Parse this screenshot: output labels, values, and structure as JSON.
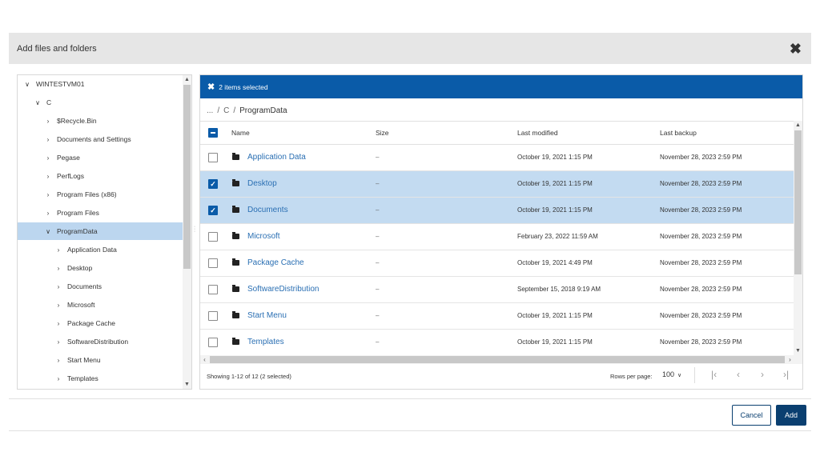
{
  "dialog": {
    "title": "Add files and folders",
    "close_icon": "close-icon"
  },
  "tree": {
    "items": [
      {
        "label": "WINTESTVM01",
        "expanded": true,
        "selected": false
      },
      {
        "label": "C",
        "expanded": true,
        "selected": false
      },
      {
        "label": "$Recycle.Bin",
        "expanded": false,
        "selected": false
      },
      {
        "label": "Documents and Settings",
        "expanded": false,
        "selected": false
      },
      {
        "label": "Pegase",
        "expanded": false,
        "selected": false
      },
      {
        "label": "PerfLogs",
        "expanded": false,
        "selected": false
      },
      {
        "label": "Program Files (x86)",
        "expanded": false,
        "selected": false
      },
      {
        "label": "Program Files",
        "expanded": false,
        "selected": false
      },
      {
        "label": "ProgramData",
        "expanded": true,
        "selected": true
      },
      {
        "label": "Application Data",
        "expanded": false,
        "selected": false
      },
      {
        "label": "Desktop",
        "expanded": false,
        "selected": false
      },
      {
        "label": "Documents",
        "expanded": false,
        "selected": false
      },
      {
        "label": "Microsoft",
        "expanded": false,
        "selected": false
      },
      {
        "label": "Package Cache",
        "expanded": false,
        "selected": false
      },
      {
        "label": "SoftwareDistribution",
        "expanded": false,
        "selected": false
      },
      {
        "label": "Start Menu",
        "expanded": false,
        "selected": false
      },
      {
        "label": "Templates",
        "expanded": false,
        "selected": false
      }
    ]
  },
  "selection_bar": {
    "text": "2 items selected"
  },
  "breadcrumb": {
    "parts": [
      "...",
      "C",
      "ProgramData"
    ],
    "separator": "/"
  },
  "grid": {
    "columns": {
      "name": "Name",
      "size": "Size",
      "modified": "Last modified",
      "backup": "Last backup"
    },
    "rows": [
      {
        "name": "Application Data",
        "size": "–",
        "modified": "October 19, 2021 1:15 PM",
        "backup": "November 28, 2023 2:59 PM",
        "selected": false
      },
      {
        "name": "Desktop",
        "size": "–",
        "modified": "October 19, 2021 1:15 PM",
        "backup": "November 28, 2023 2:59 PM",
        "selected": true
      },
      {
        "name": "Documents",
        "size": "–",
        "modified": "October 19, 2021 1:15 PM",
        "backup": "November 28, 2023 2:59 PM",
        "selected": true
      },
      {
        "name": "Microsoft",
        "size": "–",
        "modified": "February 23, 2022 11:59 AM",
        "backup": "November 28, 2023 2:59 PM",
        "selected": false
      },
      {
        "name": "Package Cache",
        "size": "–",
        "modified": "October 19, 2021 4:49 PM",
        "backup": "November 28, 2023 2:59 PM",
        "selected": false
      },
      {
        "name": "SoftwareDistribution",
        "size": "–",
        "modified": "September 15, 2018 9:19 AM",
        "backup": "November 28, 2023 2:59 PM",
        "selected": false
      },
      {
        "name": "Start Menu",
        "size": "–",
        "modified": "October 19, 2021 1:15 PM",
        "backup": "November 28, 2023 2:59 PM",
        "selected": false
      },
      {
        "name": "Templates",
        "size": "–",
        "modified": "October 19, 2021 1:15 PM",
        "backup": "November 28, 2023 2:59 PM",
        "selected": false
      }
    ]
  },
  "footer": {
    "status": "Showing 1-12 of 12 (2 selected)",
    "rows_per_page_label": "Rows per page:",
    "rows_per_page_value": "100"
  },
  "buttons": {
    "cancel": "Cancel",
    "add": "Add"
  },
  "colors": {
    "accent": "#0a5ba8",
    "primary_button": "#0a3f70",
    "row_selected": "#c3dbf1",
    "link": "#2a6fb3"
  }
}
